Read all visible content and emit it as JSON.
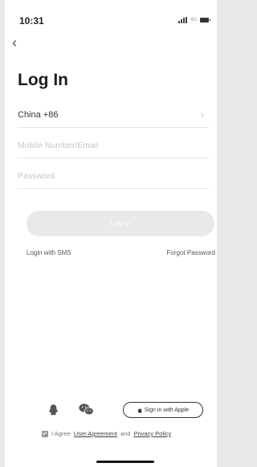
{
  "status_bar": {
    "time": "10:31",
    "network": "4G"
  },
  "page": {
    "title": "Log In"
  },
  "form": {
    "country_code": "China +86",
    "account_placeholder": "Mobile Number/Email",
    "password_placeholder": "Password",
    "login_button": "Log In"
  },
  "links": {
    "login_sms": "Login with SMS",
    "forgot_password": "Forgot Password"
  },
  "social": {
    "apple_label": "Sign in with Apple"
  },
  "agreement": {
    "prefix": "I Agree",
    "user_agreement": "User Agreement",
    "and": "and",
    "privacy_policy": "Privacy Policy",
    "checked": true
  },
  "colors": {
    "button_disabled_bg": "#e9e9e9",
    "placeholder": "#c5c5c5",
    "text": "#222222"
  }
}
